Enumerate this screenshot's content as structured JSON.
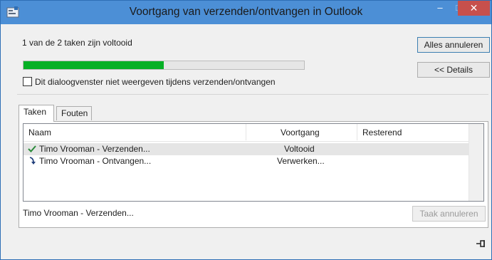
{
  "window": {
    "title": "Voortgang van verzenden/ontvangen in Outlook",
    "minimize_glyph": "–",
    "maximize_glyph": "□",
    "close_glyph": "✕"
  },
  "summary_text": "1 van de 2 taken zijn voltooid",
  "progress": {
    "fraction": 0.5,
    "color": "#06b025"
  },
  "buttons": {
    "cancel_all": "Alles annuleren",
    "details": "<< Details",
    "cancel_task": "Taak annuleren"
  },
  "checkbox": {
    "label": "Dit dialoogvenster niet weergeven tijdens verzenden/ontvangen",
    "checked": false
  },
  "tabs": [
    {
      "label": "Taken",
      "active": true
    },
    {
      "label": "Fouten",
      "active": false
    }
  ],
  "table": {
    "columns": [
      "Naam",
      "Voortgang",
      "Resterend"
    ],
    "rows": [
      {
        "icon": "checkmark-icon",
        "name": "Timo Vrooman - Verzenden...",
        "progress": "Voltooid",
        "remaining": ""
      },
      {
        "icon": "receive-arrow-icon",
        "name": "Timo Vrooman - Ontvangen...",
        "progress": "Verwerken...",
        "remaining": ""
      }
    ]
  },
  "current_task": "Timo Vrooman - Verzenden...",
  "colors": {
    "titlebar": "#4c8fd6",
    "close_button": "#c7504c"
  }
}
